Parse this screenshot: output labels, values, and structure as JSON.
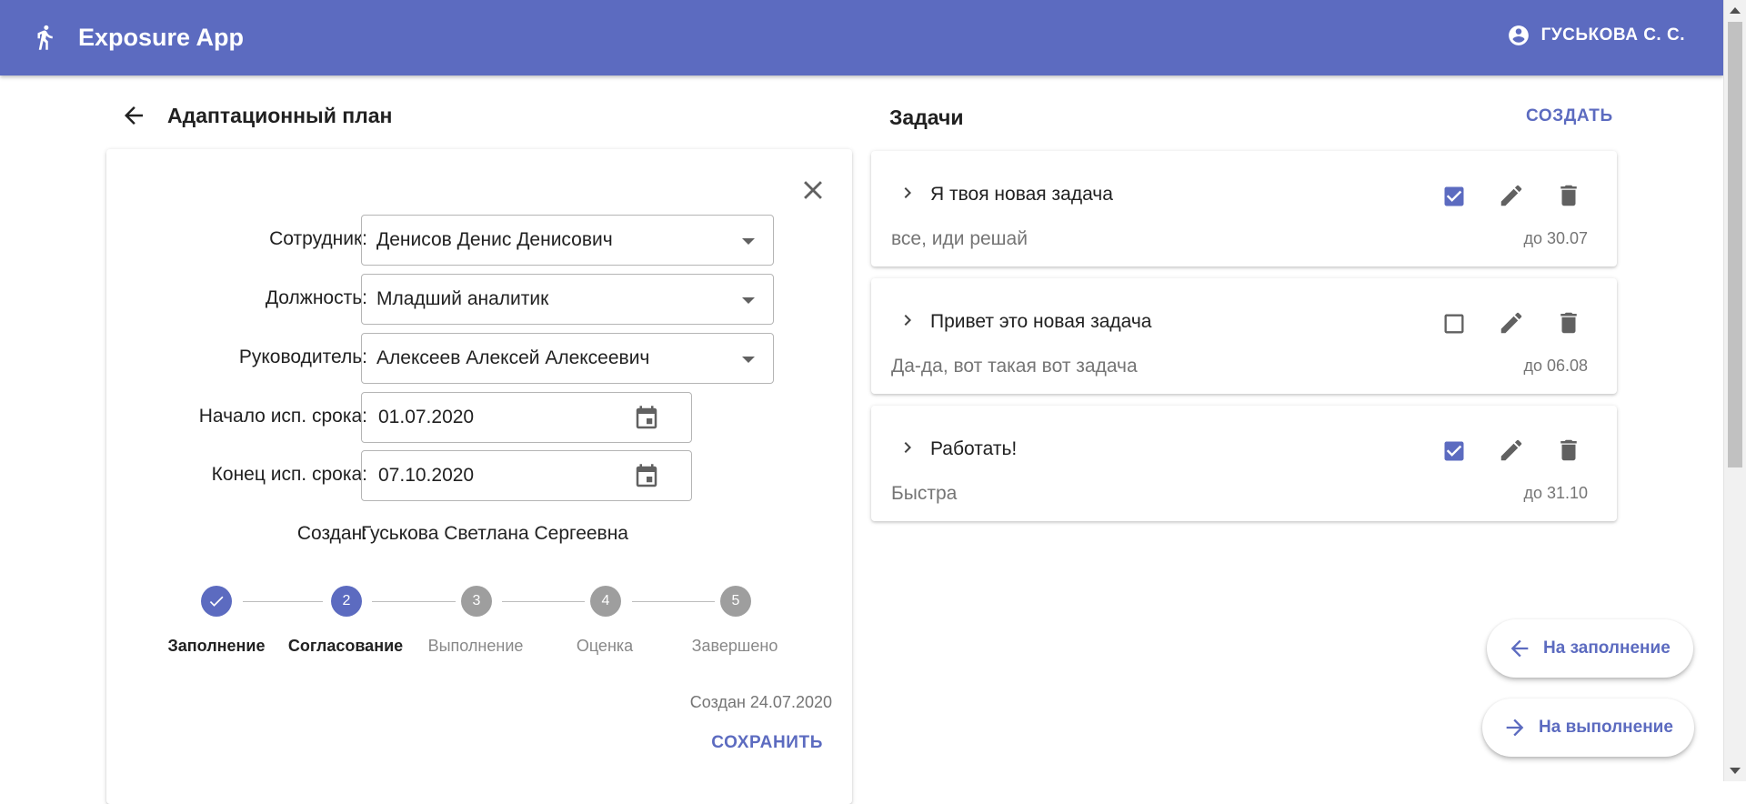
{
  "app": {
    "title": "Exposure App",
    "user_name": "ГУСЬКОВА С. С.",
    "accent_color": "#5c6bc0",
    "logo_icon": "person-walking-icon",
    "user_icon": "account-circle-icon"
  },
  "plan": {
    "title": "Адаптационный план",
    "fields": [
      {
        "label": "Сотрудник:",
        "value": "Денисов Денис Денисович",
        "type": "select"
      },
      {
        "label": "Должность:",
        "value": "Младший аналитик",
        "type": "select"
      },
      {
        "label": "Руководитель:",
        "value": "Алексеев Алексей Алексеевич",
        "type": "select"
      },
      {
        "label": "Начало исп. срока:",
        "value": "01.07.2020",
        "type": "date"
      },
      {
        "label": "Конец исп. срока:",
        "value": "07.10.2020",
        "type": "date"
      }
    ],
    "created_by_label": "Создан:",
    "created_by_value": "Гуськова Светлана Сергеевна",
    "steps": [
      {
        "number": "1",
        "label": "Заполнение",
        "state": "completed"
      },
      {
        "number": "2",
        "label": "Согласование",
        "state": "active"
      },
      {
        "number": "3",
        "label": "Выполнение",
        "state": "pending"
      },
      {
        "number": "4",
        "label": "Оценка",
        "state": "pending"
      },
      {
        "number": "5",
        "label": "Завершено",
        "state": "pending"
      }
    ],
    "created_date": "Создан 24.07.2020",
    "save_label": "СОХРАНИТЬ"
  },
  "tasks": {
    "title": "Задачи",
    "create_label": "СОЗДАТЬ",
    "items": [
      {
        "title": "Я твоя новая задача",
        "description": "все, иди решай",
        "due": "до 30.07",
        "checked": true
      },
      {
        "title": "Привет это новая задача",
        "description": "Да-да, вот такая вот задача",
        "due": "до 06.08",
        "checked": false
      },
      {
        "title": "Работать!",
        "description": "Быстра",
        "due": "до 31.10",
        "checked": true
      }
    ]
  },
  "actions": {
    "to_filling_label": "На заполнение",
    "to_execution_label": "На выполнение"
  }
}
